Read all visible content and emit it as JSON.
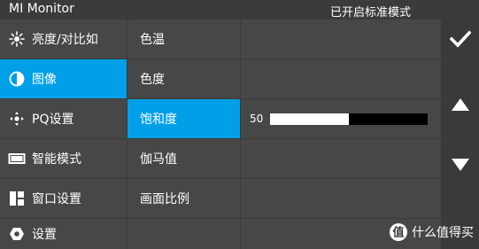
{
  "window": {
    "title": "MI Monitor",
    "mode_status": "已开启标准模式"
  },
  "menu": {
    "items": [
      {
        "label": "亮度/对比如",
        "icon": "brightness-icon"
      },
      {
        "label": "图像",
        "icon": "contrast-half-circle-icon",
        "active": true
      },
      {
        "label": "PQ设置",
        "icon": "pq-diamond-icon"
      },
      {
        "label": "智能模式",
        "icon": "smart-mode-icon"
      },
      {
        "label": "窗口设置",
        "icon": "window-layout-icon"
      },
      {
        "label": "设置",
        "icon": "settings-hexagon-icon"
      }
    ]
  },
  "submenu": {
    "items": [
      {
        "label": "色温"
      },
      {
        "label": "色度"
      },
      {
        "label": "饱和度",
        "active": true
      },
      {
        "label": "伽马值"
      },
      {
        "label": "画面比例"
      },
      {
        "label": ""
      }
    ]
  },
  "detail": {
    "saturation": {
      "value_text": "50",
      "value": 50,
      "max": 100
    }
  },
  "side_buttons": {
    "confirm": "checkmark-icon",
    "up": "arrow-up-icon",
    "down": "arrow-down-icon"
  },
  "watermark": {
    "text": "什么值得买"
  },
  "colors": {
    "accent": "#00a0e8",
    "cell": "#474747",
    "background": "#3a3a3a"
  }
}
